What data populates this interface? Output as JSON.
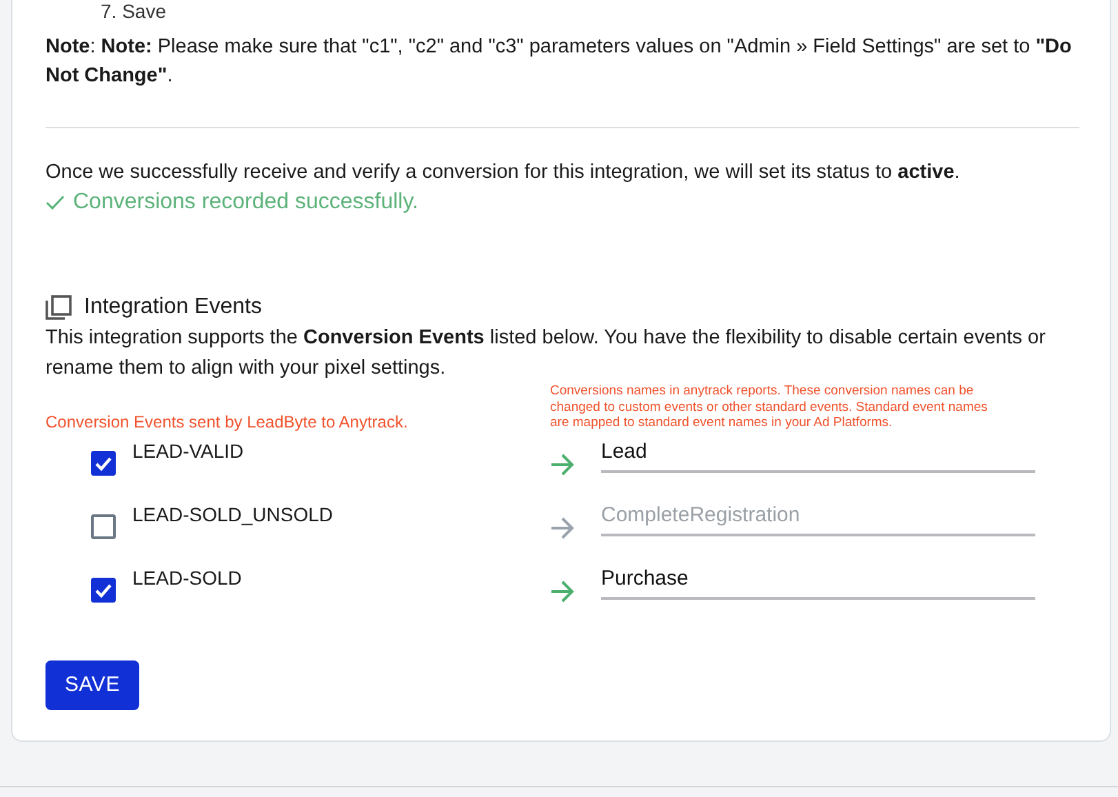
{
  "top_step": "7. Save",
  "note": "**Note**: **Note:** Please make sure that \"c1\", \"c2\" and \"c3\" parameters values on \"Admin » Field Settings\" are set to **\"Do Not Change\"**.",
  "activation_text": "Once we successfully receive and verify a conversion for this integration, we will set its status to **active**.",
  "status": {
    "kind": "success",
    "text": "Conversions recorded successfully."
  },
  "integration_events": {
    "title": "Integration Events",
    "description": "This integration supports the **Conversion Events** listed below. You have the flexibility to disable certain events or rename them to align with your pixel settings.",
    "source_hint": "Conversion Events sent by LeadByte to Anytrack.",
    "target_hint": "Conversions names in anytrack reports. These conversion names can be changed to custom events or other standard events. Standard event names are mapped to standard event names in your Ad Platforms.",
    "events": [
      {
        "name": "LEAD-VALID",
        "checked": true,
        "mapped_name": "Lead"
      },
      {
        "name": "LEAD-SOLD_UNSOLD",
        "checked": false,
        "mapped_name": "CompleteRegistration"
      },
      {
        "name": "LEAD-SOLD",
        "checked": true,
        "mapped_name": "Purchase"
      }
    ]
  },
  "save_button": "SAVE"
}
